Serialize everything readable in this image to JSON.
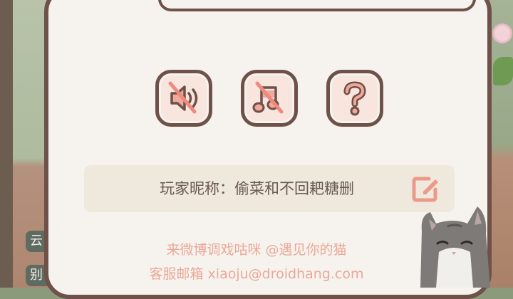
{
  "settings": {
    "sound_button": {
      "icon": "sound-muted-icon",
      "state": "off"
    },
    "music_button": {
      "icon": "music-muted-icon",
      "state": "off"
    },
    "help_button": {
      "icon": "question-icon"
    },
    "player_name_label": "玩家昵称：偷菜和不回耙糖删",
    "edit_icon": "edit-icon",
    "footer": {
      "weibo_line": "来微博调戏咕咪 @遇见你的猫",
      "support_line": "客服邮箱 xiaoju@droidhang.com"
    }
  },
  "background": {
    "chip_top": "云",
    "chip_bottom": "别"
  },
  "colors": {
    "border": "#6e5148",
    "dialog_bg": "#f6f3ee",
    "accent_pink": "#eaa897",
    "name_bar_bg": "#efe8dc"
  }
}
